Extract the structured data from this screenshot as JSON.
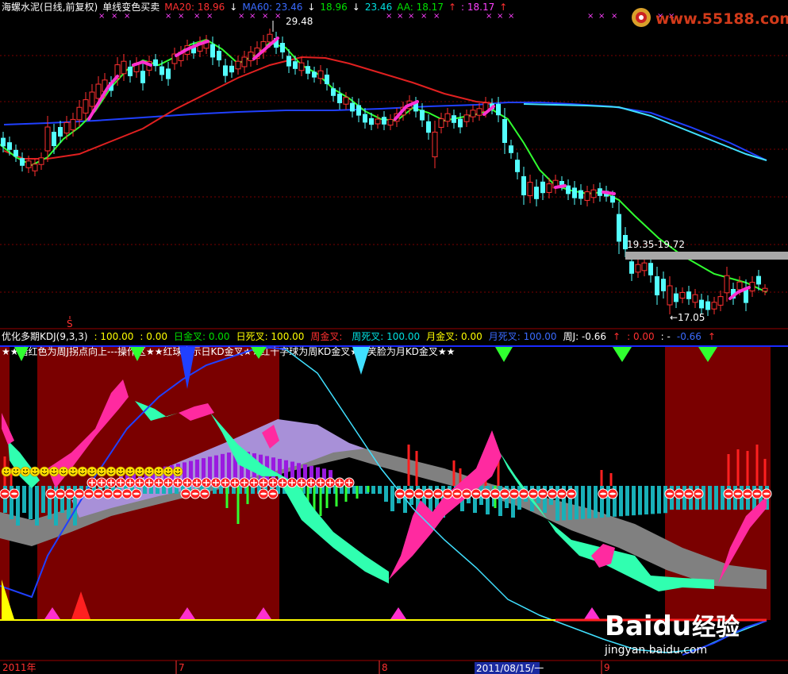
{
  "main_header": [
    {
      "text": "海螺水泥(日线,前复权)",
      "color": "#ffffff"
    },
    {
      "text": "单线变色买卖",
      "color": "#ffffff"
    },
    {
      "text": "MA20: 18.96",
      "color": "#ff3030"
    },
    {
      "text": "↓",
      "color": "#ffffff"
    },
    {
      "text": "MA60: 23.46",
      "color": "#3a6bff"
    },
    {
      "text": "↓",
      "color": "#ffffff"
    },
    {
      "text": "18.96",
      "color": "#00e000"
    },
    {
      "text": "↓",
      "color": "#ffffff"
    },
    {
      "text": "23.46",
      "color": "#00e0e0"
    },
    {
      "text": "AA: 18.17",
      "color": "#00e000"
    },
    {
      "text": "↑",
      "color": "#ff3030"
    },
    {
      "text": ": 18.17",
      "color": "#ff40ff"
    },
    {
      "text": "↑",
      "color": "#ff3030"
    }
  ],
  "watermark": "www.55188.com",
  "annotations": {
    "high_label": "29.48",
    "gap_label": "19.35-19.72",
    "low_label": "←17.05",
    "s_marker": "S"
  },
  "sub_header": [
    {
      "text": "优化多期KDJ(9,3,3)",
      "color": "#ffffff"
    },
    {
      "text": ": 100.00",
      "color": "#ffff00"
    },
    {
      "text": ": 0.00",
      "color": "#ffff00"
    },
    {
      "text": "日金叉: 0.00",
      "color": "#00e000"
    },
    {
      "text": "日死叉: 100.00",
      "color": "#ffff00"
    },
    {
      "text": "周金叉: ",
      "color": "#ff3030"
    },
    {
      "text": "周死叉: 100.00",
      "color": "#00e0e0"
    },
    {
      "text": "月金叉: 0.00",
      "color": "#ffff00"
    },
    {
      "text": "月死叉: 100.00",
      "color": "#3a6bff"
    },
    {
      "text": "周J: -0.66",
      "color": "#ffffff"
    },
    {
      "text": "↑",
      "color": "#ff3030"
    },
    {
      "text": ": 0.00",
      "color": "#ff3030"
    },
    {
      "text": ": -",
      "color": "#ffffff"
    },
    {
      "text": "-0.66",
      "color": "#3a6bff"
    },
    {
      "text": "↑",
      "color": "#ff3030"
    }
  ],
  "legend_text": "★★暗红色为周J拐点向上---操作区★★红球表示日KD金叉★★红十字球为周KD金叉★★笑脸为月KD金叉★★",
  "date_axis": [
    {
      "text": "2011年"
    },
    {
      "text": "7"
    },
    {
      "text": "8"
    },
    {
      "text": "2011/08/15/一"
    },
    {
      "text": "9"
    }
  ],
  "baidu_logo": {
    "brand": "Baidu",
    "cn": "经验",
    "url": "jingyan.baidu.com"
  },
  "colors": {
    "bg": "#000000",
    "up_candle": "#ff3030",
    "down_candle": "#54ffff",
    "ma20": "#e02020",
    "ma60": "#2040ff",
    "green_line": "#30ff30",
    "cyan_line": "#40e0ff",
    "magenta": "#ff30d0",
    "dark_red_zone": "#7a0000",
    "aqua_band": "#30ffb0",
    "pink_band": "#ff2aa0",
    "lavender_band": "#a890d8",
    "gray_band": "#808080",
    "purple_bars": "#9a1ae0",
    "cyan_bars": "#19b0b8"
  }
}
